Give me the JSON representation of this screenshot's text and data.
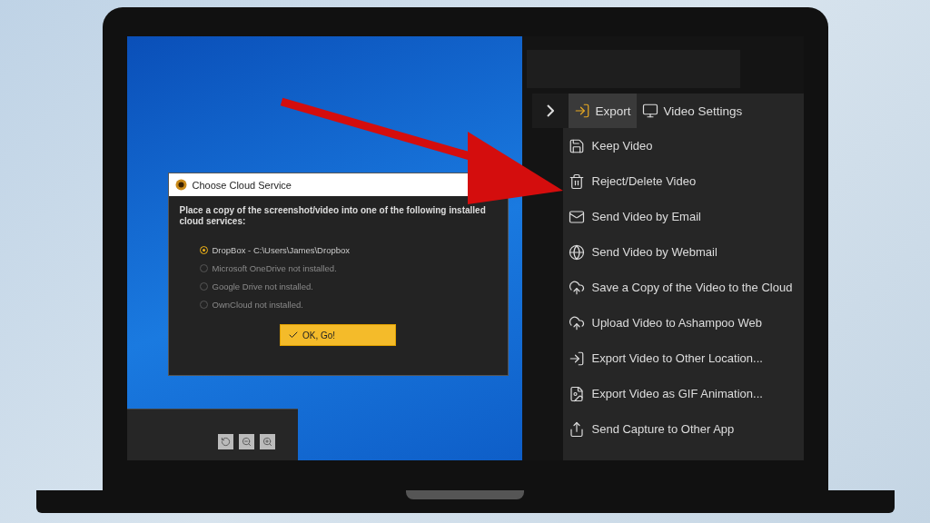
{
  "dialog": {
    "title": "Choose Cloud Service",
    "message": "Place a copy of the screenshot/video into one of the following installed cloud services:",
    "options": [
      {
        "label": "DropBox - C:\\Users\\James\\Dropbox",
        "selected": true,
        "disabled": false
      },
      {
        "label": "Microsoft OneDrive not installed.",
        "selected": false,
        "disabled": true
      },
      {
        "label": "Google Drive not installed.",
        "selected": false,
        "disabled": true
      },
      {
        "label": "OwnCloud not installed.",
        "selected": false,
        "disabled": true
      }
    ],
    "ok_button": "OK, Go!"
  },
  "toolbar": {
    "tabs": [
      {
        "label": "Export",
        "kind": "export",
        "selected": true
      },
      {
        "label": "Video Settings",
        "kind": "settings",
        "selected": false
      }
    ]
  },
  "menu": [
    {
      "label": "Keep Video",
      "kind": "save"
    },
    {
      "label": "Reject/Delete Video",
      "kind": "delete"
    },
    {
      "label": "Send Video by Email",
      "kind": "email"
    },
    {
      "label": "Send Video by Webmail",
      "kind": "web"
    },
    {
      "label": "Save a Copy of the Video to the Cloud",
      "kind": "cloud"
    },
    {
      "label": "Upload Video to Ashampoo Web",
      "kind": "upload"
    },
    {
      "label": "Export Video to Other Location...",
      "kind": "export"
    },
    {
      "label": "Export Video as GIF Animation...",
      "kind": "gif"
    },
    {
      "label": "Send Capture to Other App",
      "kind": "send"
    }
  ]
}
